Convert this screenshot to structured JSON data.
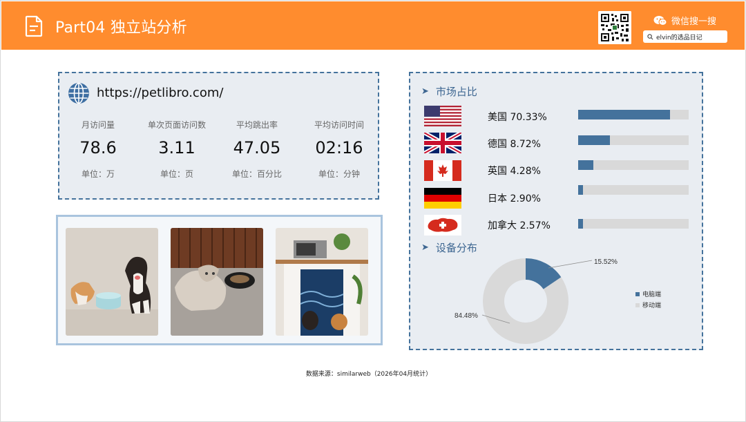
{
  "header": {
    "title": "Part04 独立站分析",
    "wechat_label": "微信搜一搜",
    "search_text": "elvin的选品日记",
    "brand_color": "#ff8c2e"
  },
  "site": {
    "url": "https://petlibro.com/",
    "metrics": [
      {
        "label": "月访问量",
        "value": "78.6",
        "unit": "单位：万"
      },
      {
        "label": "单次页面访问数",
        "value": "3.11",
        "unit": "单位：页"
      },
      {
        "label": "平均跳出率",
        "value": "47.05",
        "unit": "单位：百分比"
      },
      {
        "label": "平均访问时间",
        "value": "02:16",
        "unit": "单位：分钟"
      }
    ]
  },
  "images": [
    {
      "icon": "dog-pet-fountain-photo"
    },
    {
      "icon": "cat-feeder-photo"
    },
    {
      "icon": "cat-furniture-photo"
    }
  ],
  "market": {
    "title": "市场占比",
    "bar_color": "#44729c",
    "countries": [
      {
        "label": "美国 70.33%",
        "share": 0.8309,
        "flag": "us-flag-icon"
      },
      {
        "label": "德国 8.72%",
        "share": 0.2863,
        "flag": "uk-flag-icon"
      },
      {
        "label": "英国 4.28%",
        "share": 0.1389,
        "flag": "canada-flag-icon"
      },
      {
        "label": "日本 2.90%",
        "share": 0.0426,
        "flag": "germany-flag-icon"
      },
      {
        "label": "加拿大 2.57%",
        "share": 0.0454,
        "flag": "switzerland-flag-icon"
      }
    ]
  },
  "device": {
    "title": "设备分布",
    "legend": [
      "电脑端",
      "移动端"
    ],
    "colors": [
      "#44729c",
      "#d9d9d9"
    ]
  },
  "chart_data": {
    "type": "pie",
    "categories": [
      "电脑端",
      "移动端"
    ],
    "values": [
      15.52,
      84.48
    ],
    "labels": [
      "15.52%",
      "84.48%"
    ],
    "legend_position": "right"
  },
  "footer": {
    "source": "数据来源：similarweb（2026年04月统计）"
  }
}
